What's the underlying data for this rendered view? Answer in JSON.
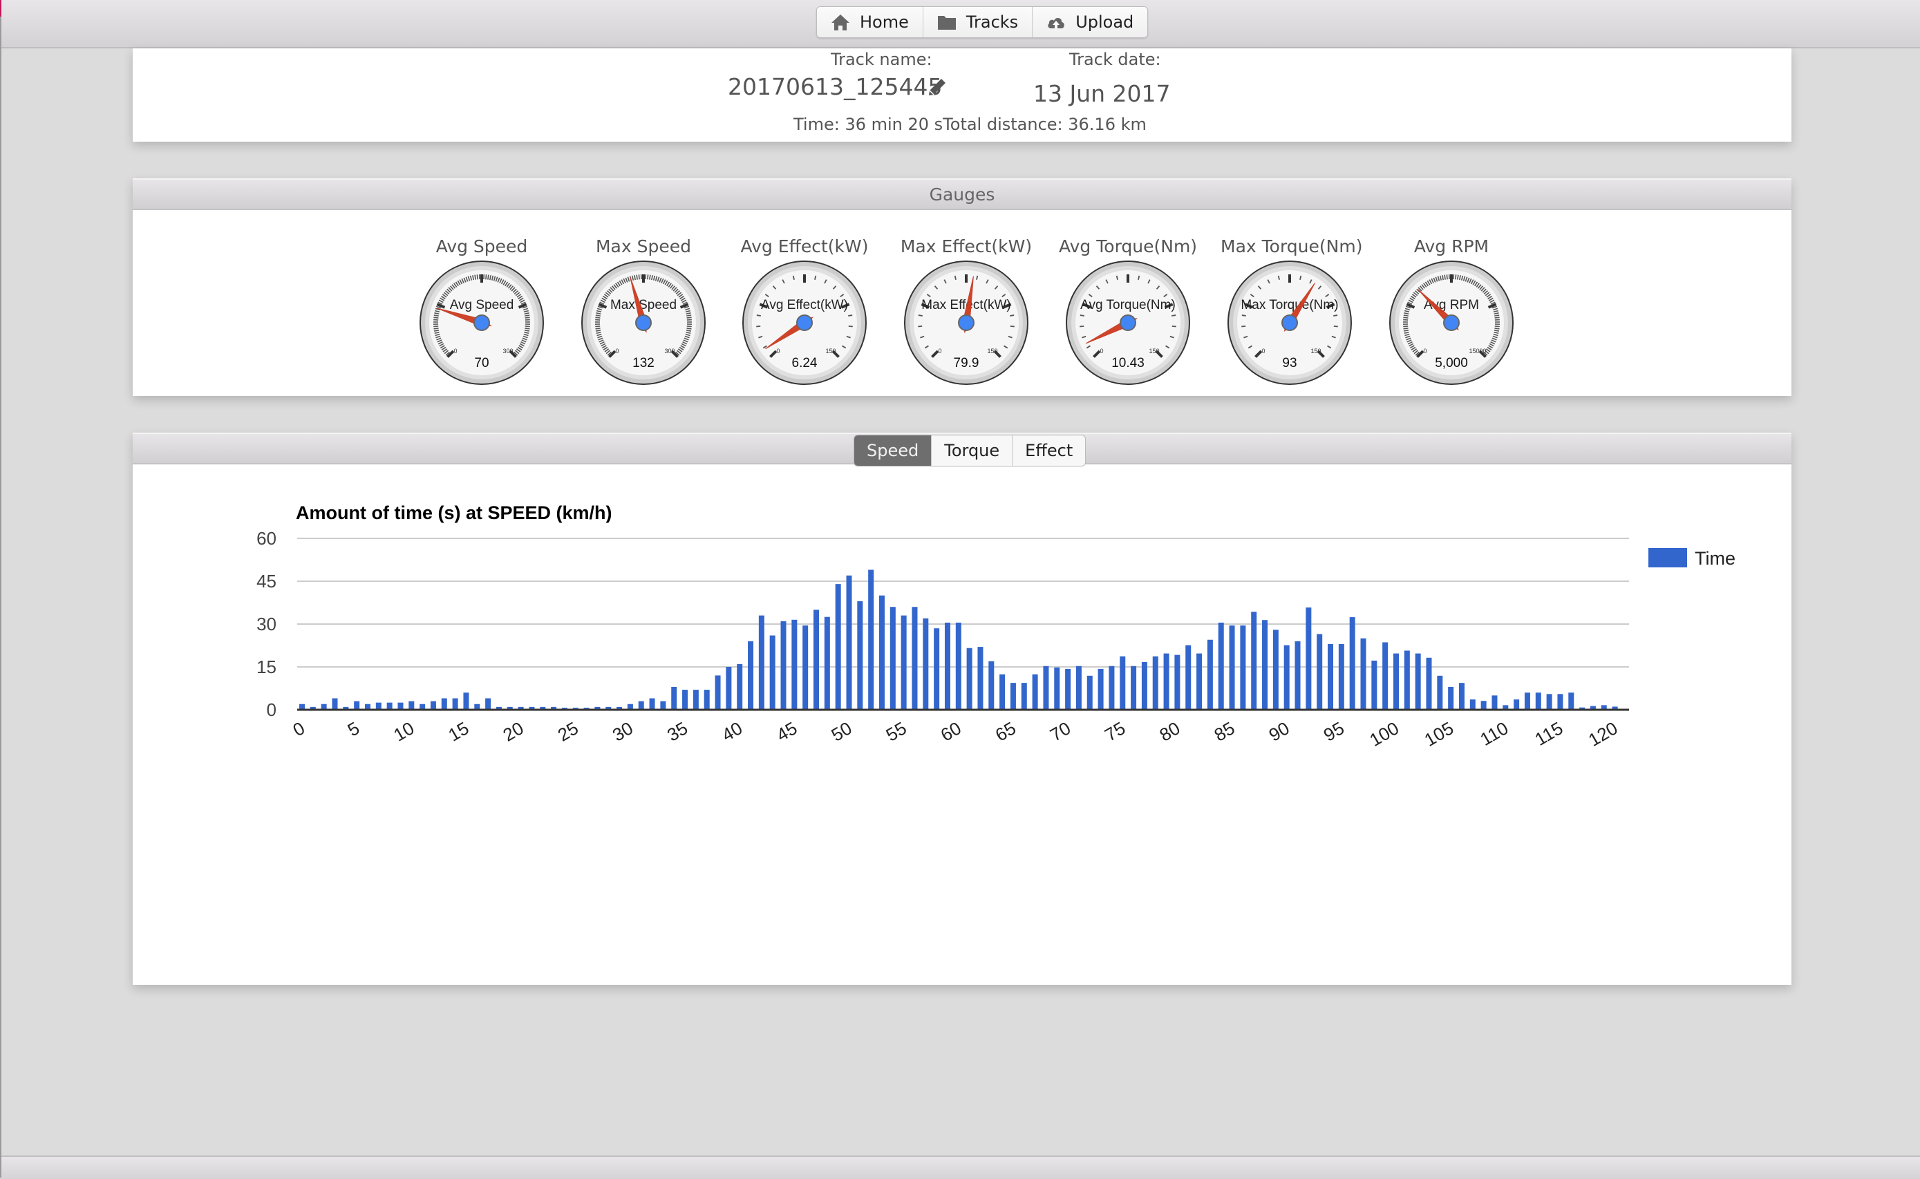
{
  "nav": {
    "items": [
      {
        "label": "Home",
        "icon": "home-icon"
      },
      {
        "label": "Tracks",
        "icon": "folder-icon"
      },
      {
        "label": "Upload",
        "icon": "cloud-upload-icon"
      }
    ]
  },
  "track": {
    "name_label": "Track name:",
    "name": "20170613_125445",
    "date_label": "Track date:",
    "date": "13 Jun 2017",
    "summary": "Time: 36 min 20 sTotal distance: 36.16 km"
  },
  "gauges": {
    "header": "Gauges",
    "colors": {
      "needle": "#d03a1f",
      "hub": "#4285f4"
    },
    "items": [
      {
        "title": "Avg Speed",
        "inner_label": "Avg Speed",
        "value": 70,
        "display": "70",
        "min": 0,
        "max": 300,
        "min_label": "0",
        "max_label": "300",
        "fine_ticks": true
      },
      {
        "title": "Max Speed",
        "inner_label": "Max Speed",
        "value": 132,
        "display": "132",
        "min": 0,
        "max": 300,
        "min_label": "0",
        "max_label": "300",
        "fine_ticks": true
      },
      {
        "title": "Avg Effect(kW)",
        "inner_label": "Avg Effect(kW)",
        "value": 6.24,
        "display": "6.24",
        "min": 0,
        "max": 150,
        "min_label": "0",
        "max_label": "150",
        "fine_ticks": false
      },
      {
        "title": "Max Effect(kW)",
        "inner_label": "Max Effect(kW)",
        "value": 79.9,
        "display": "79.9",
        "min": 0,
        "max": 150,
        "min_label": "0",
        "max_label": "150",
        "fine_ticks": false
      },
      {
        "title": "Avg Torque(Nm)",
        "inner_label": "Avg Torque(Nm)",
        "value": 10.43,
        "display": "10.43",
        "min": 0,
        "max": 150,
        "min_label": "0",
        "max_label": "150",
        "fine_ticks": false
      },
      {
        "title": "Max Torque(Nm)",
        "inner_label": "Max Torque(Nm)",
        "value": 93,
        "display": "93",
        "min": 0,
        "max": 150,
        "min_label": "0",
        "max_label": "150",
        "fine_ticks": false
      },
      {
        "title": "Avg RPM",
        "inner_label": "Avg RPM",
        "value": 5000,
        "display": "5,000",
        "min": 0,
        "max": 15000,
        "min_label": "0",
        "max_label": "15000",
        "fine_ticks": true
      }
    ]
  },
  "chart_tabs": {
    "items": [
      {
        "label": "Speed",
        "active": true
      },
      {
        "label": "Torque",
        "active": false
      },
      {
        "label": "Effect",
        "active": false
      }
    ]
  },
  "chart_data": {
    "type": "bar",
    "title": "Amount of time (s) at SPEED (km/h)",
    "xlabel": "",
    "ylabel": "",
    "ylim": [
      0,
      60
    ],
    "yticks": [
      0,
      15,
      30,
      45,
      60
    ],
    "xticks": [
      0,
      5,
      10,
      15,
      20,
      25,
      30,
      35,
      40,
      45,
      50,
      55,
      60,
      65,
      70,
      75,
      80,
      85,
      90,
      95,
      100,
      105,
      110,
      115,
      120
    ],
    "grid": true,
    "legend": "right",
    "bar_color": "#3366cc",
    "series": [
      {
        "name": "Time",
        "x_start": 0,
        "x_step": 1,
        "values": [
          2,
          1,
          2,
          4,
          1,
          3,
          2,
          2.5,
          2.5,
          2.5,
          3,
          2,
          3,
          4,
          4,
          6,
          2,
          4,
          1,
          1,
          1,
          1,
          1,
          1,
          0.7,
          0.7,
          0.7,
          1,
          1,
          1,
          2,
          3,
          4,
          3,
          8,
          7,
          7,
          7,
          12,
          15,
          16,
          24,
          33,
          26,
          31,
          31.5,
          29.5,
          35,
          32.5,
          44,
          47,
          38,
          49,
          40,
          36,
          33,
          36,
          32,
          28.5,
          30.5,
          30.5,
          21.6,
          22,
          17,
          12.4,
          9.4,
          9.4,
          12.4,
          15.3,
          14.8,
          14.3,
          15.3,
          11.9,
          14.3,
          15.3,
          18.7,
          15.3,
          16.7,
          18.7,
          19.7,
          19.2,
          22.6,
          19.7,
          24.5,
          30.5,
          29.5,
          29.5,
          34.3,
          31.4,
          28,
          22.6,
          24,
          35.8,
          26.5,
          23,
          23,
          32.4,
          25,
          17.2,
          23.6,
          19.7,
          20.7,
          19.7,
          18.2,
          11.9,
          8,
          9.4,
          3.6,
          3.1,
          5,
          1.6,
          3.6,
          6,
          6,
          5.5,
          5.5,
          6,
          0.8,
          1.3,
          1.6,
          1.1
        ]
      }
    ]
  }
}
